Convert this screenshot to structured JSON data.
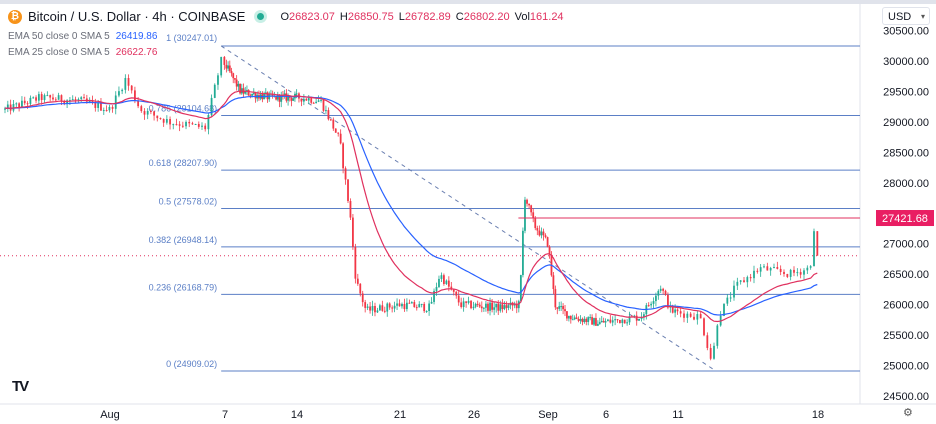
{
  "header": {
    "symbol": "Bitcoin / U.S. Dollar · 4h · COINBASE",
    "ohlc": [
      {
        "k": "O",
        "v": "26823.07"
      },
      {
        "k": "H",
        "v": "26850.75"
      },
      {
        "k": "L",
        "v": "26782.89"
      },
      {
        "k": "C",
        "v": "26802.20"
      },
      {
        "k": "Vol",
        "v": "161.24"
      }
    ]
  },
  "indicators": [
    {
      "label": "EMA 50 close 0 SMA 5",
      "value": "26419.86",
      "color": "#2962ff"
    },
    {
      "label": "EMA 25 close 0 SMA 5",
      "value": "26622.76",
      "color": "#e0315f"
    }
  ],
  "currency": "USD",
  "chart_data": {
    "type": "candlestick",
    "title": "Bitcoin / U.S. Dollar · 4h · COINBASE",
    "y_ticks": [
      "30500.00",
      "30000.00",
      "29500.00",
      "29000.00",
      "28500.00",
      "28000.00",
      "27500.00",
      "27000.00",
      "26500.00",
      "26000.00",
      "25500.00",
      "25000.00",
      "24500.00"
    ],
    "x_ticks": [
      {
        "label": "Aug",
        "day": 0
      },
      {
        "label": "7",
        "day": 6
      },
      {
        "label": "14",
        "day": 13
      },
      {
        "label": "21",
        "day": 20
      },
      {
        "label": "26",
        "day": 25
      },
      {
        "label": "Sep",
        "day": 31
      },
      {
        "label": "6",
        "day": 36
      },
      {
        "label": "11",
        "day": 41
      },
      {
        "label": "18",
        "day": 48
      }
    ],
    "ylim": [
      24300,
      30600
    ],
    "price_path": [
      [
        -6.2,
        29200
      ],
      [
        -4.1,
        29400
      ],
      [
        -1.8,
        29350
      ],
      [
        0,
        29200
      ],
      [
        0.8,
        29700
      ],
      [
        1.6,
        29200
      ],
      [
        3.1,
        29000
      ],
      [
        5.0,
        28900
      ],
      [
        5.2,
        29200
      ],
      [
        5.8,
        30000
      ],
      [
        6.5,
        29800
      ],
      [
        7.5,
        29500
      ],
      [
        10.4,
        29400
      ],
      [
        13.2,
        29400
      ],
      [
        14.6,
        29350
      ],
      [
        15.9,
        28700
      ],
      [
        16.6,
        27500
      ],
      [
        17.0,
        26400
      ],
      [
        17.7,
        25900
      ],
      [
        20,
        26000
      ],
      [
        22.0,
        25950
      ],
      [
        22.7,
        26500
      ],
      [
        24.1,
        26000
      ],
      [
        27.1,
        25950
      ],
      [
        28.7,
        26000
      ],
      [
        29.1,
        27800
      ],
      [
        29.9,
        27300
      ],
      [
        31,
        27000
      ],
      [
        31.6,
        26000
      ],
      [
        32.9,
        25800
      ],
      [
        35.5,
        25700
      ],
      [
        38.4,
        25800
      ],
      [
        39.8,
        26300
      ],
      [
        40.5,
        25900
      ],
      [
        42.1,
        25800
      ],
      [
        42.7,
        25050
      ],
      [
        43.0,
        25800
      ],
      [
        43.9,
        26300
      ],
      [
        45.1,
        26600
      ],
      [
        46.6,
        26500
      ],
      [
        47.6,
        26600
      ],
      [
        47.85,
        27300
      ],
      [
        48.1,
        26802.2
      ]
    ],
    "fib_levels": [
      {
        "ratio": "1",
        "price": 30247.01,
        "label": "1 (30247.01)"
      },
      {
        "ratio": "0.786",
        "price": 29104.68,
        "label": "0.786 (29104.68)"
      },
      {
        "ratio": "0.618",
        "price": 28207.9,
        "label": "0.618 (28207.90)"
      },
      {
        "ratio": "0.5",
        "price": 27578.02,
        "label": "0.5 (27578.02)"
      },
      {
        "ratio": "0.382",
        "price": 26948.14,
        "label": "0.382 (26948.14)"
      },
      {
        "ratio": "0.236",
        "price": 26168.79,
        "label": "0.236 (26168.79)"
      },
      {
        "ratio": "0",
        "price": 24909.02,
        "label": "0 (24909.02)"
      }
    ],
    "fib_trend": {
      "from": {
        "day": 5.8,
        "price": 30247.01
      },
      "to": {
        "day": 42.9,
        "price": 24909.02
      }
    },
    "resistance": {
      "price": 27421.68,
      "label": "27421.68",
      "from_day": 28.6
    },
    "last_price": 26802.2,
    "colors": {
      "up": "#22ab94",
      "down": "#f23645",
      "ema50": "#2962ff",
      "ema25": "#e0315f",
      "fib": "#5b7fc6"
    }
  },
  "footer": {
    "logo": "TV"
  }
}
